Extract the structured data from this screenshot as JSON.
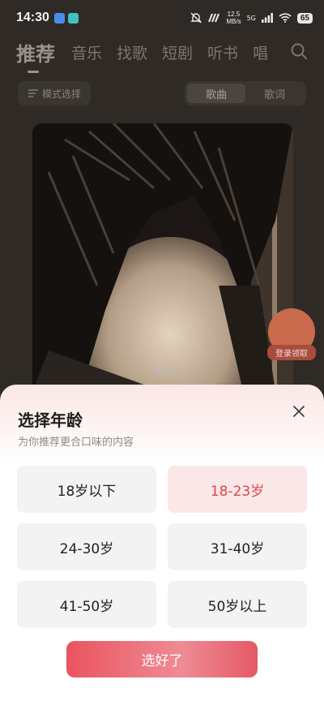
{
  "status_bar": {
    "time": "14:30",
    "speed_value": "12.5",
    "speed_unit": "MB/s",
    "network": "5G",
    "battery": "65"
  },
  "nav": {
    "tabs": [
      "推荐",
      "音乐",
      "找歌",
      "短剧",
      "听书",
      "唱"
    ],
    "active_index": 0
  },
  "toolbar": {
    "mode_label": "模式选择",
    "segments": [
      "歌曲",
      "歌词"
    ],
    "active_segment": 0
  },
  "banner": {
    "gift_label": "登录领取"
  },
  "age_sheet": {
    "title": "选择年龄",
    "subtitle": "为你推荐更合口味的内容",
    "options": [
      "18岁以下",
      "18-23岁",
      "24-30岁",
      "31-40岁",
      "41-50岁",
      "50岁以上"
    ],
    "selected_index": 1,
    "confirm_label": "选好了"
  },
  "colors": {
    "accent": "#d7474d",
    "selected_bg": "#fbe7e7",
    "option_bg": "#f3f3f3"
  }
}
